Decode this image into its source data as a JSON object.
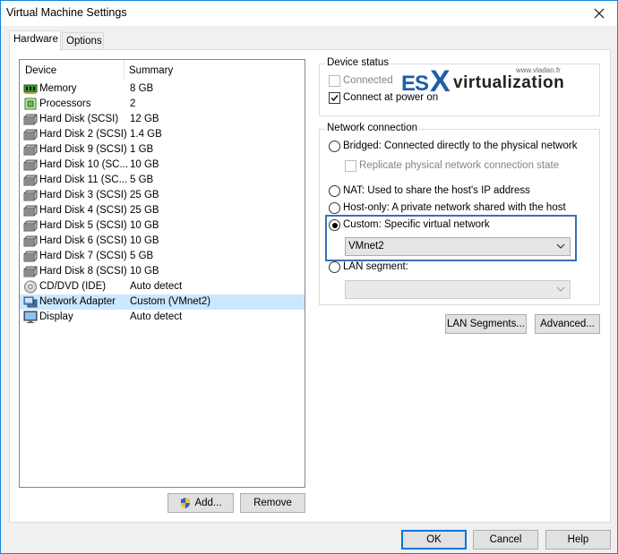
{
  "window": {
    "title": "Virtual Machine Settings",
    "close_icon": "close-icon"
  },
  "tabs": [
    {
      "label": "Hardware",
      "active": true
    },
    {
      "label": "Options",
      "active": false
    }
  ],
  "device_list": {
    "columns": {
      "device": "Device",
      "summary": "Summary"
    },
    "rows": [
      {
        "icon": "memory-icon",
        "name": "Memory",
        "summary": "8 GB",
        "selected": false
      },
      {
        "icon": "processor-icon",
        "name": "Processors",
        "summary": "2",
        "selected": false
      },
      {
        "icon": "hard-disk-icon",
        "name": "Hard Disk (SCSI)",
        "summary": "12 GB",
        "selected": false
      },
      {
        "icon": "hard-disk-icon",
        "name": "Hard Disk 2 (SCSI)",
        "summary": "1.4 GB",
        "selected": false
      },
      {
        "icon": "hard-disk-icon",
        "name": "Hard Disk 9 (SCSI)",
        "summary": "1 GB",
        "selected": false
      },
      {
        "icon": "hard-disk-icon",
        "name": "Hard Disk 10 (SC...",
        "summary": "10 GB",
        "selected": false
      },
      {
        "icon": "hard-disk-icon",
        "name": "Hard Disk 11 (SC...",
        "summary": "5 GB",
        "selected": false
      },
      {
        "icon": "hard-disk-icon",
        "name": "Hard Disk 3 (SCSI)",
        "summary": "25 GB",
        "selected": false
      },
      {
        "icon": "hard-disk-icon",
        "name": "Hard Disk 4 (SCSI)",
        "summary": "25 GB",
        "selected": false
      },
      {
        "icon": "hard-disk-icon",
        "name": "Hard Disk 5 (SCSI)",
        "summary": "10 GB",
        "selected": false
      },
      {
        "icon": "hard-disk-icon",
        "name": "Hard Disk 6 (SCSI)",
        "summary": "10 GB",
        "selected": false
      },
      {
        "icon": "hard-disk-icon",
        "name": "Hard Disk 7 (SCSI)",
        "summary": "5 GB",
        "selected": false
      },
      {
        "icon": "hard-disk-icon",
        "name": "Hard Disk 8 (SCSI)",
        "summary": "10 GB",
        "selected": false
      },
      {
        "icon": "cd-dvd-icon",
        "name": "CD/DVD (IDE)",
        "summary": "Auto detect",
        "selected": false
      },
      {
        "icon": "network-adapter-icon",
        "name": "Network Adapter",
        "summary": "Custom (VMnet2)",
        "selected": true
      },
      {
        "icon": "display-icon",
        "name": "Display",
        "summary": "Auto detect",
        "selected": false
      }
    ],
    "add_label": "Add...",
    "remove_label": "Remove"
  },
  "device_status": {
    "title": "Device status",
    "connected_label": "Connected",
    "connected_checked": false,
    "connected_disabled": true,
    "connect_at_power_on_label": "Connect at power on",
    "connect_at_power_on_checked": true
  },
  "watermark": {
    "es": "ES",
    "x": "X",
    "virtualization": "virtualization",
    "url": "www.vladan.fr"
  },
  "network_connection": {
    "title": "Network connection",
    "options": [
      {
        "id": "bridged",
        "label": "Bridged: Connected directly to the physical network",
        "selected": false
      },
      {
        "id": "nat",
        "label": "NAT: Used to share the host's IP address",
        "selected": false
      },
      {
        "id": "host-only",
        "label": "Host-only: A private network shared with the host",
        "selected": false
      },
      {
        "id": "custom",
        "label": "Custom: Specific virtual network",
        "selected": true
      },
      {
        "id": "lan-segment",
        "label": "LAN segment:",
        "selected": false
      }
    ],
    "replicate_label": "Replicate physical network connection state",
    "replicate_checked": false,
    "custom_network_value": "VMnet2",
    "lan_segment_value": ""
  },
  "lan_buttons": {
    "lan_segments_label": "LAN Segments...",
    "advanced_label": "Advanced..."
  },
  "footer": {
    "ok_label": "OK",
    "cancel_label": "Cancel",
    "help_label": "Help"
  },
  "colors": {
    "selection": "#cce8ff",
    "highlight_border": "#3c6fb8",
    "window_border": "#1883d7",
    "primary_button_border": "#0078d7"
  }
}
